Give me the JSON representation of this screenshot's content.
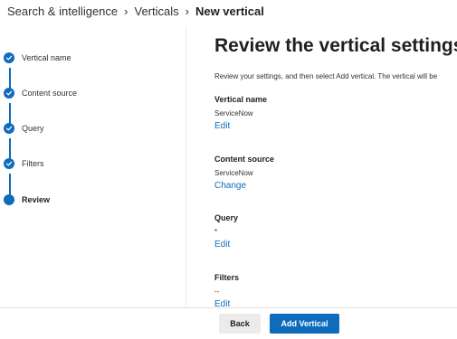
{
  "breadcrumb": {
    "items": [
      "Search & intelligence",
      "Verticals"
    ],
    "current": "New vertical"
  },
  "steps": [
    {
      "label": "Vertical name",
      "state": "complete",
      "icon": "checkmark-icon"
    },
    {
      "label": "Content source",
      "state": "complete",
      "icon": "checkmark-icon"
    },
    {
      "label": "Query",
      "state": "complete",
      "icon": "checkmark-icon"
    },
    {
      "label": "Filters",
      "state": "complete",
      "icon": "checkmark-icon"
    },
    {
      "label": "Review",
      "state": "current",
      "icon": "current-step-dot"
    }
  ],
  "main": {
    "title": "Review the vertical settings",
    "description": "Review your settings, and then select Add vertical. The vertical will be",
    "sections": [
      {
        "heading": "Vertical name",
        "value": "ServiceNow",
        "link": "Edit"
      },
      {
        "heading": "Content source",
        "value": "ServiceNow",
        "link": "Change"
      },
      {
        "heading": "Query",
        "value": "*",
        "link": "Edit"
      },
      {
        "heading": "Filters",
        "value": "--",
        "link": "Edit"
      }
    ]
  },
  "footer": {
    "back_label": "Back",
    "add_label": "Add Vertical"
  },
  "colors": {
    "accent": "#0f6cbd",
    "text": "#201f1e",
    "secondary_button": "#edebe9"
  }
}
